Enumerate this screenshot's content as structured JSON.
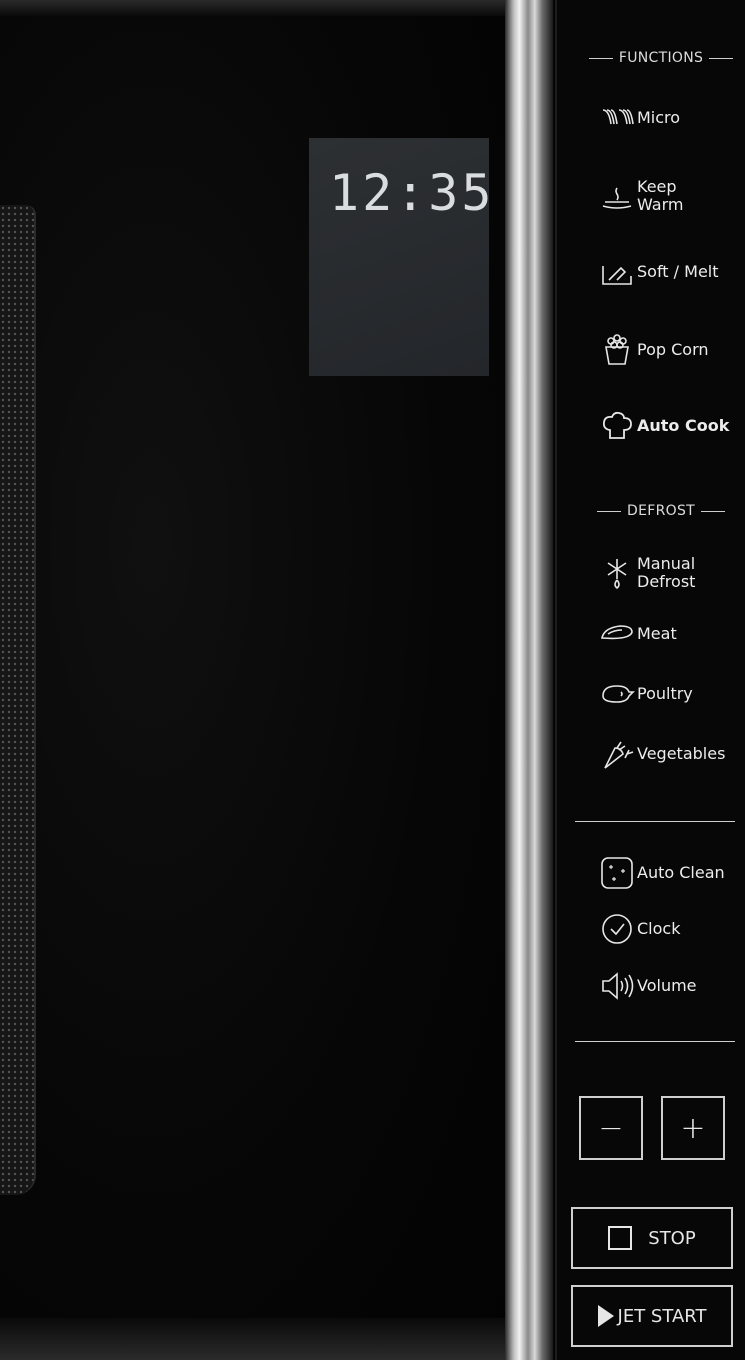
{
  "display": {
    "time": "12:35"
  },
  "panel": {
    "functions_label": "FUNCTIONS",
    "functions": [
      {
        "label": "Micro",
        "icon": "microwave-waves-icon"
      },
      {
        "label": "Keep\nWarm",
        "icon": "plate-steam-icon"
      },
      {
        "label": "Soft / Melt",
        "icon": "melt-icon"
      },
      {
        "label": "Pop Corn",
        "icon": "popcorn-icon"
      },
      {
        "label": "Auto Cook",
        "icon": "chef-hat-icon"
      }
    ],
    "defrost_label": "DEFROST",
    "defrost": [
      {
        "label": "Manual\nDefrost",
        "icon": "snowflake-drop-icon"
      },
      {
        "label": "Meat",
        "icon": "meat-icon"
      },
      {
        "label": "Poultry",
        "icon": "poultry-icon"
      },
      {
        "label": "Vegetables",
        "icon": "vegetables-icon"
      }
    ],
    "settings": [
      {
        "label": "Auto Clean",
        "icon": "auto-clean-icon"
      },
      {
        "label": "Clock",
        "icon": "clock-icon"
      },
      {
        "label": "Volume",
        "icon": "speaker-icon"
      }
    ],
    "minus_symbol": "−",
    "plus_symbol": "+",
    "stop_label": "STOP",
    "jet_start_label": "JET START"
  }
}
